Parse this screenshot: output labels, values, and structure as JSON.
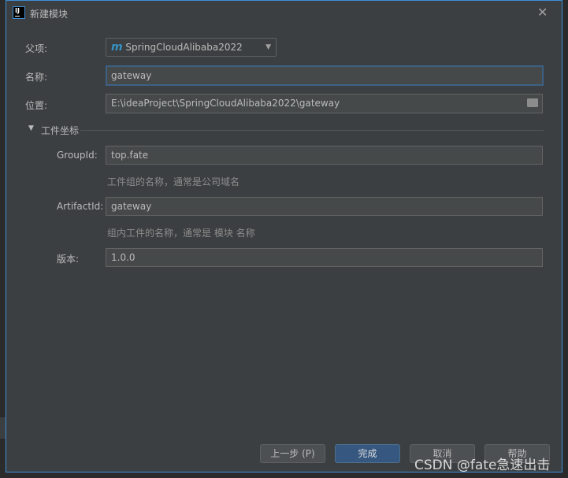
{
  "window": {
    "title": "新建模块",
    "app_icon": "intellij-icon"
  },
  "form": {
    "parent_label": "父项:",
    "parent_value": "SpringCloudAlibaba2022",
    "parent_icon": "maven-m-icon",
    "name_label": "名称:",
    "name_value": "gateway",
    "location_label": "位置:",
    "location_value": "E:\\ideaProject\\SpringCloudAlibaba2022\\gateway",
    "section_title": "工件坐标",
    "group_label": "GroupId:",
    "group_value": "top.fate",
    "group_hint": "工件组的名称，通常是公司域名",
    "artifact_label": "ArtifactId:",
    "artifact_value": "gateway",
    "artifact_hint": "组内工件的名称，通常是 模块 名称",
    "version_label": "版本:",
    "version_value": "1.0.0"
  },
  "buttons": {
    "previous": "上一步 (P)",
    "finish": "完成",
    "cancel": "取消",
    "help": "帮助"
  },
  "watermark": "CSDN @fate急速出击",
  "colors": {
    "accent": "#3d8fd8",
    "primary_button": "#365880",
    "maven": "#3592c4"
  }
}
